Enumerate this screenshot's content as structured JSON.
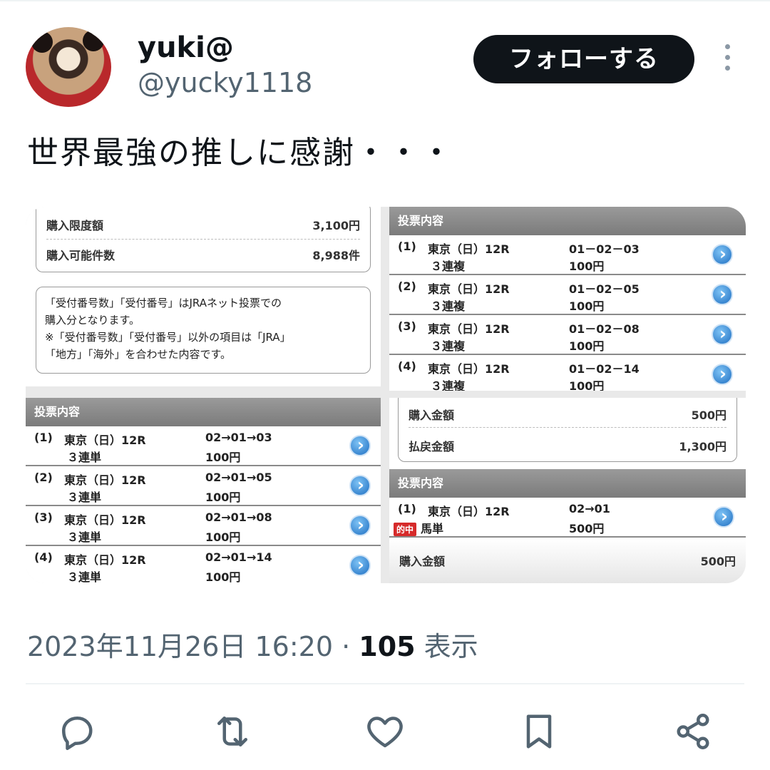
{
  "user": {
    "display_name": "yuki@",
    "handle": "@yucky1118",
    "follow_label": "フォローする"
  },
  "tweet": {
    "text": "世界最強の推しに感謝・・・",
    "timestamp": "2023年11月26日 16:20",
    "separator": " · ",
    "views_count": "105",
    "views_label": " 表示"
  },
  "media": {
    "panel1": {
      "limit_label": "購入限度額",
      "limit_value": "3,100円",
      "count_label": "購入可能件数",
      "count_value": "8,988件",
      "note_line1": "「受付番号数」「受付番号」はJRAネット投票での",
      "note_line2": "購入分となります。",
      "note_line3": "※「受付番号数」「受付番号」以外の項目は「JRA」",
      "note_line4": "「地方」「海外」を合わせた内容です。"
    },
    "panel2": {
      "header": "投票内容",
      "rows": [
        {
          "no": "(1)",
          "race": "東京（日）12R",
          "type": "３連複",
          "combo": "01－02－03",
          "amount": "100円"
        },
        {
          "no": "(2)",
          "race": "東京（日）12R",
          "type": "３連複",
          "combo": "01－02－05",
          "amount": "100円"
        },
        {
          "no": "(3)",
          "race": "東京（日）12R",
          "type": "３連複",
          "combo": "01－02－08",
          "amount": "100円"
        },
        {
          "no": "(4)",
          "race": "東京（日）12R",
          "type": "３連複",
          "combo": "01－02－14",
          "amount": "100円"
        }
      ]
    },
    "panel3": {
      "header": "投票内容",
      "rows": [
        {
          "no": "(1)",
          "race": "東京（日）12R",
          "type": "３連単",
          "combo": "02→01→03",
          "amount": "100円"
        },
        {
          "no": "(2)",
          "race": "東京（日）12R",
          "type": "３連単",
          "combo": "02→01→05",
          "amount": "100円"
        },
        {
          "no": "(3)",
          "race": "東京（日）12R",
          "type": "３連単",
          "combo": "02→01→08",
          "amount": "100円"
        },
        {
          "no": "(4)",
          "race": "東京（日）12R",
          "type": "３連単",
          "combo": "02→01→14",
          "amount": "100円"
        }
      ]
    },
    "panel4": {
      "purchase_label": "購入金額",
      "purchase_value": "500円",
      "payout_label": "払戻金額",
      "payout_value": "1,300円",
      "header": "投票内容",
      "row": {
        "no": "(1)",
        "race": "東京（日）12R",
        "badge": "的中",
        "type": "馬単",
        "combo": "02→01",
        "amount": "500円"
      },
      "total_label": "購入金額",
      "total_value": "500円"
    }
  },
  "actions": [
    "reply-icon",
    "retweet-icon",
    "like-icon",
    "bookmark-icon",
    "share-icon"
  ],
  "colors": {
    "follow_bg": "#0f1419",
    "secondary_text": "#536471",
    "hit_badge": "#d62a2a"
  }
}
